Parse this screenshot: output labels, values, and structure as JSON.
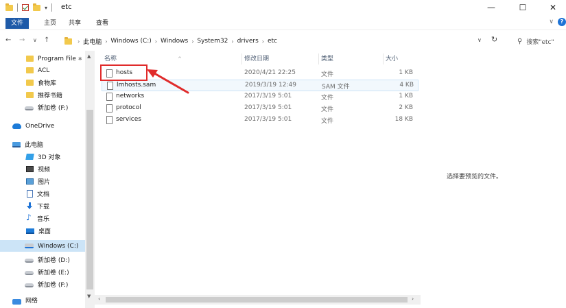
{
  "window": {
    "title": "etc",
    "minimize": "—",
    "maximize": "☐",
    "close": "✕"
  },
  "ribbon": {
    "tabs": [
      "文件",
      "主页",
      "共享",
      "查看"
    ],
    "collapse": "∨"
  },
  "address": {
    "back": "←",
    "forward": "→",
    "recent": "∨",
    "up": "↑",
    "crumbs": [
      "此电脑",
      "Windows (C:)",
      "Windows",
      "System32",
      "drivers",
      "etc"
    ],
    "dropdown": "∨",
    "refresh": "↻",
    "search_placeholder": "搜索\"etc\""
  },
  "nav": {
    "items": [
      {
        "label": "Program File",
        "icon": "folder-icon"
      },
      {
        "label": "ACL",
        "icon": "folder-icon"
      },
      {
        "label": "食物库",
        "icon": "folder-icon"
      },
      {
        "label": "推荐书籍",
        "icon": "folder-icon"
      },
      {
        "label": "新加卷 (F:)",
        "icon": "drive-icon"
      },
      {
        "label": "OneDrive",
        "icon": "cloud-icon"
      },
      {
        "label": "此电脑",
        "icon": "computer-icon"
      },
      {
        "label": "3D 对象",
        "icon": "3d-objects-icon"
      },
      {
        "label": "视频",
        "icon": "video-icon"
      },
      {
        "label": "图片",
        "icon": "pictures-icon"
      },
      {
        "label": "文档",
        "icon": "documents-icon"
      },
      {
        "label": "下载",
        "icon": "download-icon"
      },
      {
        "label": "音乐",
        "icon": "music-icon"
      },
      {
        "label": "桌面",
        "icon": "desktop-icon"
      },
      {
        "label": "Windows (C:)",
        "icon": "windows-drive-icon"
      },
      {
        "label": "新加卷 (D:)",
        "icon": "drive-icon"
      },
      {
        "label": "新加卷 (E:)",
        "icon": "drive-icon"
      },
      {
        "label": "新加卷 (F:)",
        "icon": "drive-icon"
      },
      {
        "label": "网络",
        "icon": "network-icon"
      }
    ],
    "pinned_marker": "✱"
  },
  "columns": {
    "name": "名称",
    "date": "修改日期",
    "type": "类型",
    "size": "大小"
  },
  "files": [
    {
      "name": "hosts",
      "date": "2020/4/21 22:25",
      "type": "文件",
      "size": "1 KB"
    },
    {
      "name": "lmhosts.sam",
      "date": "2019/3/19 12:49",
      "type": "SAM 文件",
      "size": "4 KB"
    },
    {
      "name": "networks",
      "date": "2017/3/19 5:01",
      "type": "文件",
      "size": "1 KB"
    },
    {
      "name": "protocol",
      "date": "2017/3/19 5:01",
      "type": "文件",
      "size": "2 KB"
    },
    {
      "name": "services",
      "date": "2017/3/19 5:01",
      "type": "文件",
      "size": "18 KB"
    }
  ],
  "preview": {
    "empty_text": "选择要预览的文件。"
  },
  "colors": {
    "accent": "#1e5aa8",
    "highlight": "#e02b2b",
    "selection": "#cce4f7"
  }
}
